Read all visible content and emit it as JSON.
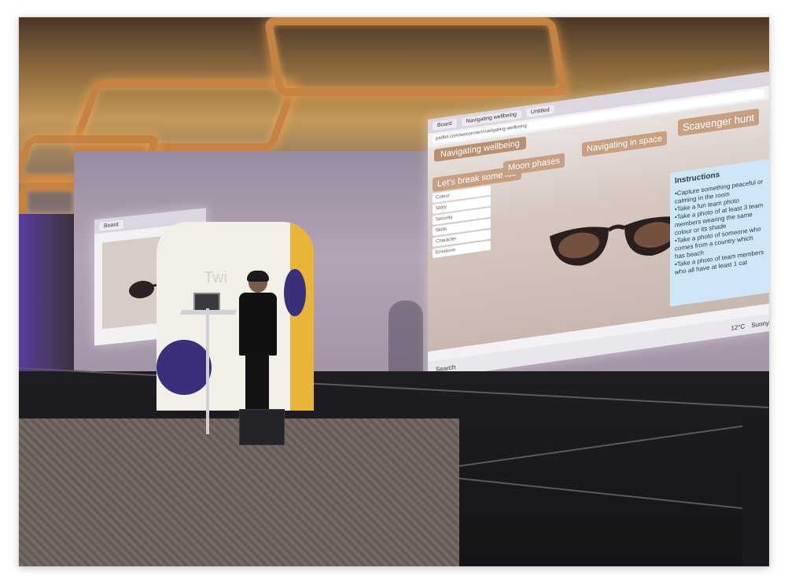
{
  "photo": {
    "description_tag": "Speaker presenting on stage with projected screens",
    "screen_right": {
      "tabs": [
        "Board",
        "Navigating wellbeing",
        "Untitled"
      ],
      "url": "padlet.com/weconnect/navigating-wellbeing",
      "board_title": "Navigating wellbeing",
      "columns": [
        "Let's break some ice",
        "Moon phases",
        "Navigating in space",
        "Scavenger hunt"
      ],
      "side_menu": [
        "Colour",
        "Story",
        "Security",
        "Skills",
        "Character",
        "Emotions"
      ],
      "panel": {
        "title": "Instructions",
        "lines": [
          "•Capture something peaceful or calming in the room",
          "•Take a fun team photo",
          "•Take a photo of at least 3 team members wearing the same colour or its shade",
          "•Take a photo of someone who comes from a country which has beach",
          "•Take a photo of team members who all have at least 1 cat"
        ]
      },
      "taskbar": {
        "search": "Search",
        "weather": "12°C",
        "weather_desc": "Sunny"
      }
    },
    "banner_text": "Twi"
  }
}
